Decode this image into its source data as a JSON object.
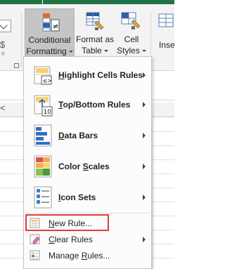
{
  "ribbon": {
    "number_glyph_1": "$",
    "number_glyph_2": "⁰",
    "conditional_formatting": {
      "line1": "Conditional",
      "line2": "Formatting"
    },
    "format_as_table": {
      "line1": "Format as",
      "line2": "Table"
    },
    "cell_styles": {
      "line1": "Cell",
      "line2": "Styles"
    },
    "insert_partial": "Inse"
  },
  "grid": {
    "x_mark": "<"
  },
  "menu": {
    "items": [
      {
        "prefix": "",
        "hotkey": "H",
        "rest": "ighlight Cells Rules",
        "bold": true,
        "arrow": true,
        "icon": "highlight-cells-icon"
      },
      {
        "prefix": "",
        "hotkey": "T",
        "rest": "op/Bottom Rules",
        "bold": true,
        "arrow": true,
        "icon": "top-bottom-icon"
      },
      {
        "prefix": "",
        "hotkey": "D",
        "rest": "ata Bars",
        "bold": true,
        "arrow": true,
        "icon": "data-bars-icon"
      },
      {
        "prefix": "Color ",
        "hotkey": "S",
        "rest": "cales",
        "bold": true,
        "arrow": true,
        "icon": "color-scales-icon"
      },
      {
        "prefix": "",
        "hotkey": "I",
        "rest": "con Sets",
        "bold": true,
        "arrow": true,
        "icon": "icon-sets-icon"
      },
      {
        "prefix": "",
        "hotkey": "N",
        "rest": "ew Rule...",
        "bold": false,
        "arrow": false,
        "icon": "new-rule-icon"
      },
      {
        "prefix": "",
        "hotkey": "C",
        "rest": "lear Rules",
        "bold": false,
        "arrow": true,
        "icon": "clear-rules-icon"
      },
      {
        "prefix": "Manage ",
        "hotkey": "R",
        "rest": "ules...",
        "bold": false,
        "arrow": false,
        "icon": "manage-rules-icon"
      }
    ],
    "icon_texts": {
      "highlight": "≤>",
      "top_bottom": "10"
    }
  },
  "colors": {
    "excel_green": "#217346",
    "ribbon_bg": "#f3f3f3",
    "active_button": "#c5c5c5",
    "highlight_red": "#e03c3c"
  }
}
